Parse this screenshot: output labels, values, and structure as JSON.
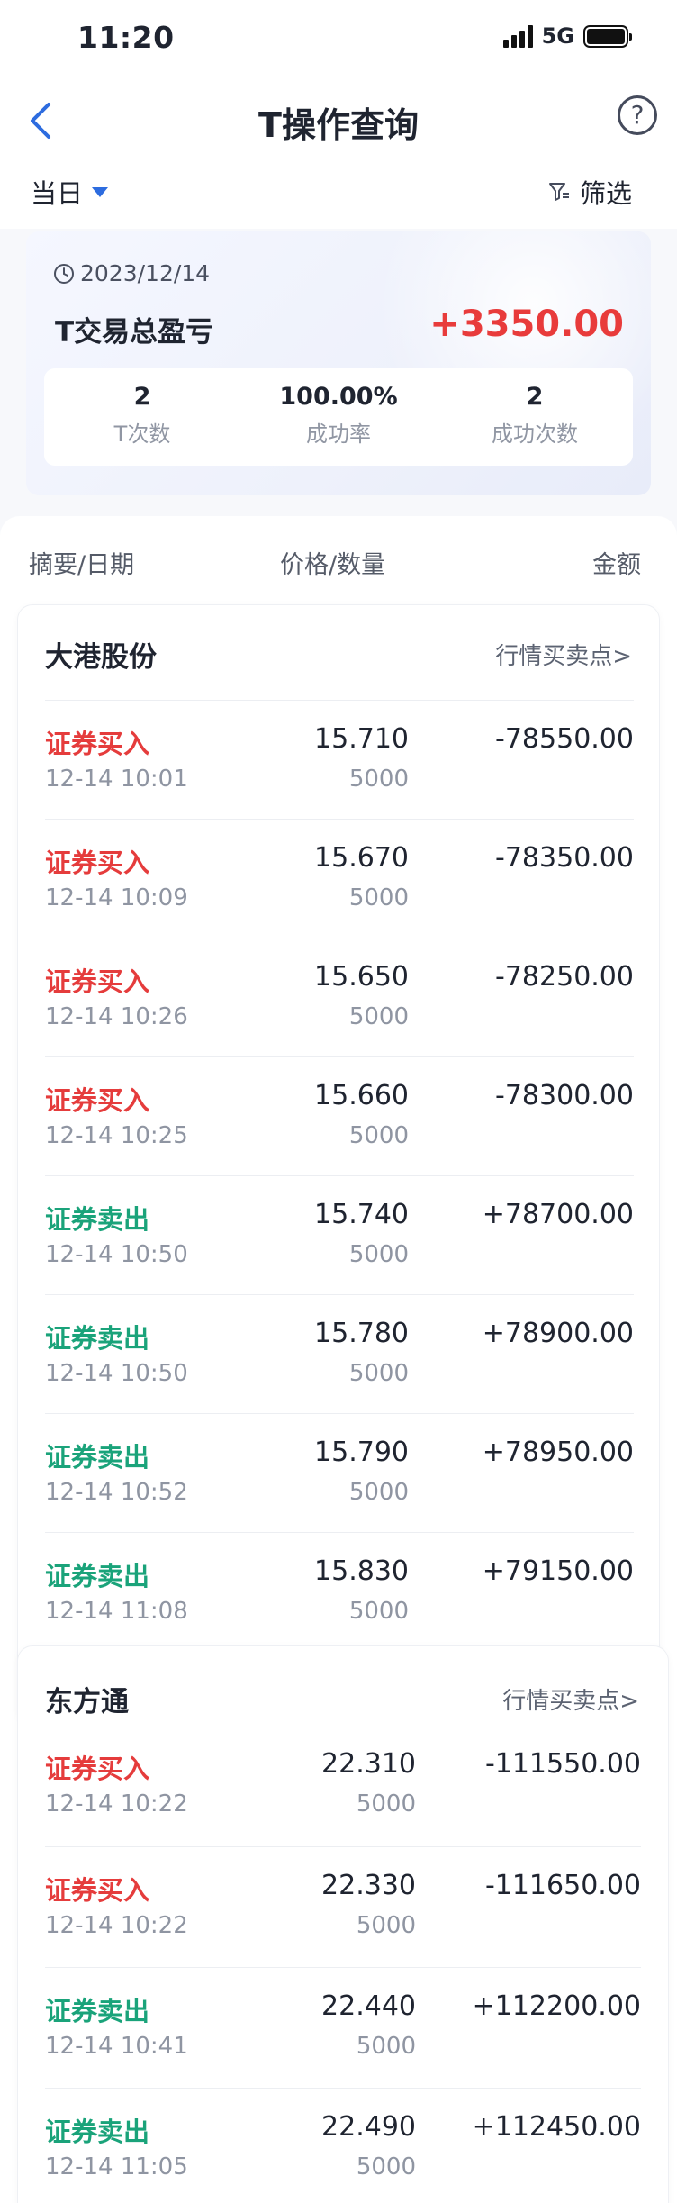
{
  "status_bar": {
    "time": "11:20",
    "network": "5G"
  },
  "nav": {
    "title": "T操作查询",
    "help_symbol": "?"
  },
  "filter": {
    "period": "当日",
    "filter_label": "筛选"
  },
  "summary": {
    "date": "2023/12/14",
    "label": "T交易总盈亏",
    "value": "+3350.00",
    "stats": [
      {
        "value": "2",
        "label": "T次数"
      },
      {
        "value": "100.00%",
        "label": "成功率"
      },
      {
        "value": "2",
        "label": "成功次数"
      }
    ]
  },
  "list_header": {
    "col1": "摘要/日期",
    "col2": "价格/数量",
    "col3": "金额"
  },
  "stocks": [
    {
      "name": "大港股份",
      "link": "行情买卖点>",
      "trades": [
        {
          "type": "证券买入",
          "side": "buy",
          "time": "12-14 10:01",
          "price": "15.710",
          "qty": "5000",
          "amount": "-78550.00"
        },
        {
          "type": "证券买入",
          "side": "buy",
          "time": "12-14 10:09",
          "price": "15.670",
          "qty": "5000",
          "amount": "-78350.00"
        },
        {
          "type": "证券买入",
          "side": "buy",
          "time": "12-14 10:26",
          "price": "15.650",
          "qty": "5000",
          "amount": "-78250.00"
        },
        {
          "type": "证券买入",
          "side": "buy",
          "time": "12-14 10:25",
          "price": "15.660",
          "qty": "5000",
          "amount": "-78300.00"
        },
        {
          "type": "证券卖出",
          "side": "sell",
          "time": "12-14 10:50",
          "price": "15.740",
          "qty": "5000",
          "amount": "+78700.00"
        },
        {
          "type": "证券卖出",
          "side": "sell",
          "time": "12-14 10:50",
          "price": "15.780",
          "qty": "5000",
          "amount": "+78900.00"
        },
        {
          "type": "证券卖出",
          "side": "sell",
          "time": "12-14 10:52",
          "price": "15.790",
          "qty": "5000",
          "amount": "+78950.00"
        },
        {
          "type": "证券卖出",
          "side": "sell",
          "time": "12-14 11:08",
          "price": "15.830",
          "qty": "5000",
          "amount": "+79150.00"
        }
      ]
    },
    {
      "name": "东方通",
      "link": "行情买卖点>",
      "trades": [
        {
          "type": "证券买入",
          "side": "buy",
          "time": "12-14 10:22",
          "price": "22.310",
          "qty": "5000",
          "amount": "-111550.00"
        },
        {
          "type": "证券买入",
          "side": "buy",
          "time": "12-14 10:22",
          "price": "22.330",
          "qty": "5000",
          "amount": "-111650.00"
        },
        {
          "type": "证券卖出",
          "side": "sell",
          "time": "12-14 10:41",
          "price": "22.440",
          "qty": "5000",
          "amount": "+112200.00"
        },
        {
          "type": "证券卖出",
          "side": "sell",
          "time": "12-14 11:05",
          "price": "22.490",
          "qty": "5000",
          "amount": "+112450.00"
        }
      ]
    }
  ],
  "colors": {
    "buy": "#e53c3c",
    "sell": "#1aa37a",
    "profit": "#e83b3b",
    "accent": "#2d6cdf"
  },
  "icons": {
    "back": "chevron-left-icon",
    "help": "question-circle-icon",
    "filter": "funnel-icon",
    "date": "clock-icon",
    "period": "caret-down-icon"
  }
}
